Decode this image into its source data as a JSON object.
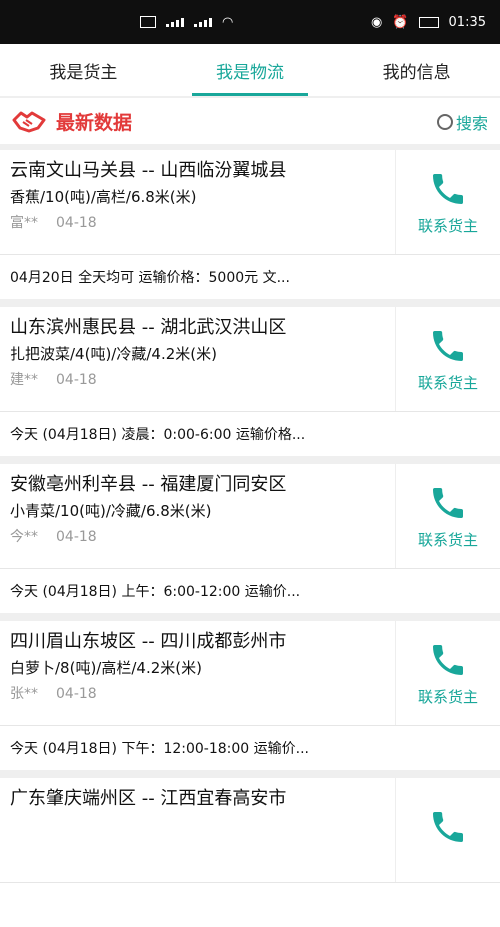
{
  "status_bar": {
    "time": "01:35"
  },
  "tabs": [
    {
      "label": "我是货主",
      "active": false
    },
    {
      "label": "我是物流",
      "active": true
    },
    {
      "label": "我的信息",
      "active": false
    }
  ],
  "section": {
    "title": "最新数据",
    "search_label": "搜索"
  },
  "colors": {
    "accent": "#19a79a",
    "title_red": "#e23a3a"
  },
  "cards": [
    {
      "route": "云南文山马关县 -- 山西临汾翼城县",
      "goods": "香蕉/10(吨)/高栏/6.8米(米)",
      "owner": "富**",
      "date": "04-18",
      "footer": "04月20日 全天均可 运输价格：5000元 文...",
      "contact": "联系货主"
    },
    {
      "route": "山东滨州惠民县 -- 湖北武汉洪山区",
      "goods": "扎把波菜/4(吨)/冷藏/4.2米(米)",
      "owner": "建**",
      "date": "04-18",
      "footer": "今天 (04月18日) 凌晨：0:00-6:00 运输价格...",
      "contact": "联系货主"
    },
    {
      "route": "安徽亳州利辛县 -- 福建厦门同安区",
      "goods": "小青菜/10(吨)/冷藏/6.8米(米)",
      "owner": "今**",
      "date": "04-18",
      "footer": "今天 (04月18日) 上午：6:00-12:00 运输价...",
      "contact": "联系货主"
    },
    {
      "route": "四川眉山东坡区 -- 四川成都彭州市",
      "goods": "白萝卜/8(吨)/高栏/4.2米(米)",
      "owner": "张**",
      "date": "04-18",
      "footer": "今天 (04月18日) 下午：12:00-18:00 运输价...",
      "contact": "联系货主"
    },
    {
      "route": "广东肇庆端州区 -- 江西宜春高安市",
      "goods": "",
      "owner": "",
      "date": "",
      "footer": "",
      "contact": ""
    }
  ]
}
